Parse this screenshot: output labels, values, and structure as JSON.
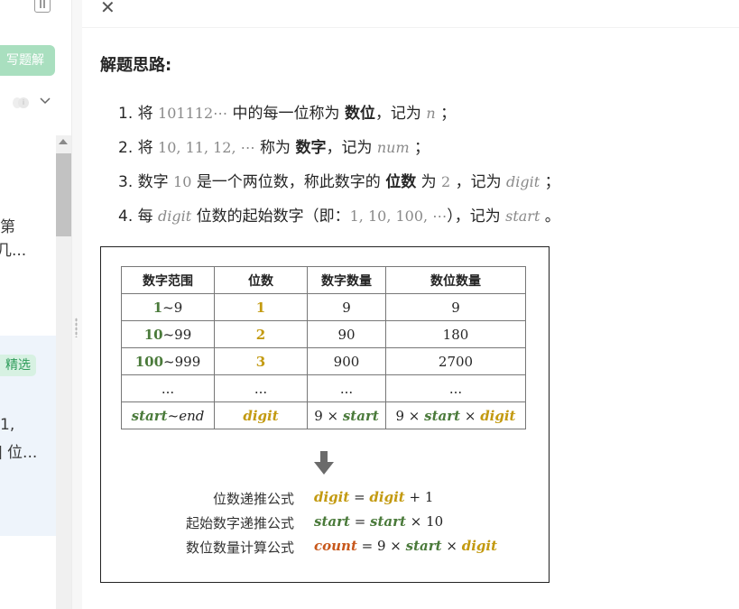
{
  "left_panel": {
    "write_button_label": "写题解",
    "text_1": "第",
    "text_2": "几...",
    "tag_label": "精选",
    "text_3": "1,",
    "text_4": "] 位..."
  },
  "main": {
    "heading": "解题思路:",
    "steps": [
      {
        "num": "1.",
        "p1": "将",
        "m1": "101112⋯",
        "p2": "中的每一位称为",
        "bold": "数位",
        "p3": "，记为",
        "m2": "n",
        "p4": "；"
      },
      {
        "num": "2.",
        "p1": "将",
        "m1": "10, 11, 12, ⋯",
        "p2": "称为",
        "bold": "数字",
        "p3": "，记为",
        "m2": "num",
        "p4": "；"
      },
      {
        "num": "3.",
        "p1": "数字",
        "m1": "10",
        "p2": "是一个两位数，称此数字的",
        "bold": "位数",
        "p3": "为",
        "m2": "2",
        "p4": "，记为",
        "m3": "digit",
        "p5": "；"
      },
      {
        "num": "4.",
        "p1": "每",
        "m1": "digit",
        "p2": "位数的起始数字（即：",
        "m2": "1, 10, 100, ⋯",
        "p3": "），记为",
        "m3": "start",
        "p4": "。"
      }
    ]
  },
  "figure": {
    "headers": [
      "数字范围",
      "位数",
      "数字数量",
      "数位数量"
    ],
    "rows": [
      {
        "range_a": "1",
        "range_b": "~9",
        "digits": "1",
        "count": "9",
        "positions": "9"
      },
      {
        "range_a": "10",
        "range_b": "~99",
        "digits": "2",
        "count": "90",
        "positions": "180"
      },
      {
        "range_a": "100",
        "range_b": "~999",
        "digits": "3",
        "count": "900",
        "positions": "2700"
      },
      {
        "range_a": "...",
        "range_b": "",
        "digits": "...",
        "count": "...",
        "positions": "..."
      }
    ],
    "last_row": {
      "range_a": "start",
      "range_tilde": "~",
      "range_b": "end",
      "digits": "digit",
      "count_a": "9 × ",
      "count_b": "start",
      "pos_a": "9 × ",
      "pos_b": "start",
      "pos_c": " × ",
      "pos_d": "digit"
    },
    "formulas": [
      {
        "label": "位数递推公式",
        "lhs": "digit",
        "eq": " = ",
        "r1": "digit",
        "r2": " + 1"
      },
      {
        "label": "起始数字递推公式",
        "lhs": "start",
        "eq": " = ",
        "r1": "start",
        "r2": " × 10"
      },
      {
        "label": "数位数量计算公式",
        "lhs": "count",
        "eq": " = 9 × ",
        "r1": "start",
        "r2": " × ",
        "r3": "digit"
      }
    ]
  },
  "colors": {
    "green": "#4a7a3a",
    "yellow": "#c39a10",
    "orange": "#c8581c",
    "accent_button": "#a9dfbf"
  }
}
